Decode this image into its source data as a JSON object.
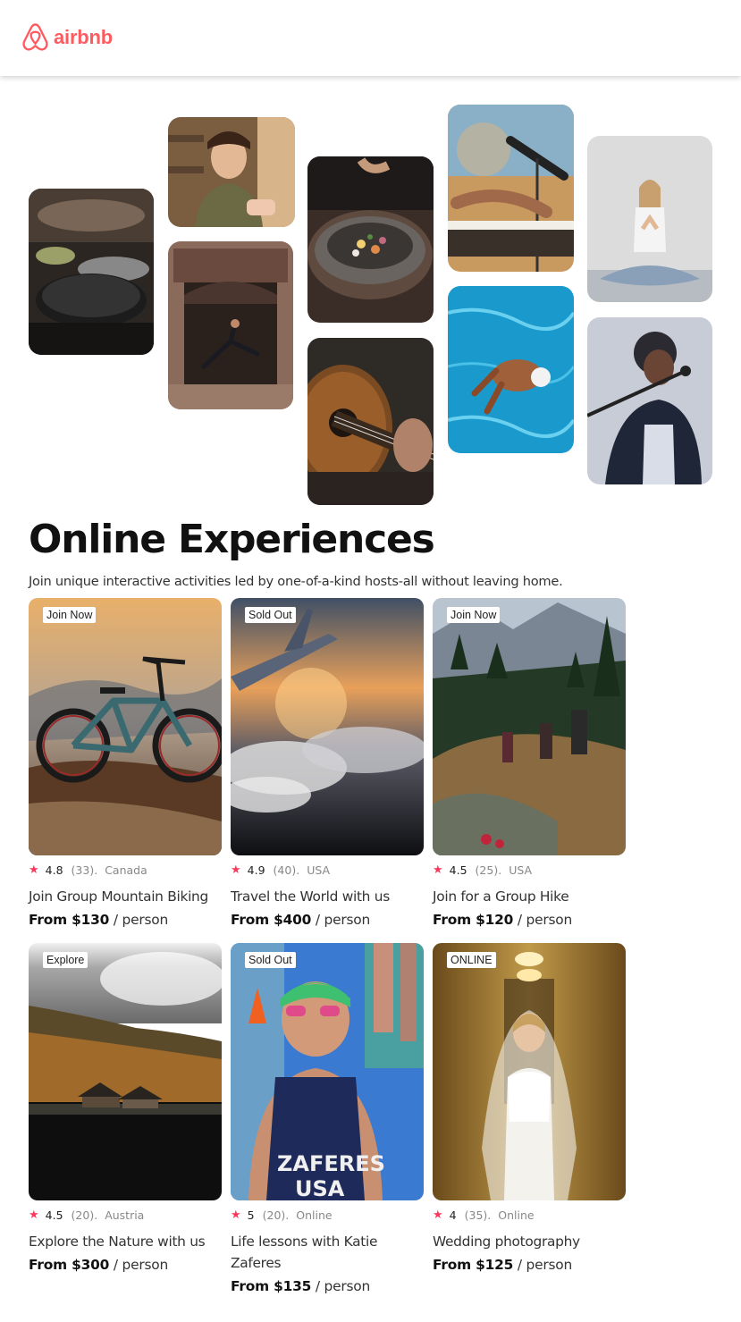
{
  "header": {
    "brand": "airbnb",
    "brand_color": "#ff5a5f",
    "logo_icon": "airbnb-belo-icon"
  },
  "gallery": [
    {
      "subject": "cooking-pans",
      "colors": [
        "#2a2a2a",
        "#6b5a4a"
      ]
    },
    {
      "subject": "chef-woman",
      "colors": [
        "#6e5238",
        "#c9a17b"
      ]
    },
    {
      "subject": "dancer-doorway",
      "colors": [
        "#7a5a4a",
        "#3b2a22"
      ]
    },
    {
      "subject": "food-bowl",
      "colors": [
        "#4a3a30",
        "#8d7a6a"
      ]
    },
    {
      "subject": "guitar",
      "colors": [
        "#3a2a20",
        "#7a5030"
      ]
    },
    {
      "subject": "piano-microphone",
      "colors": [
        "#8ab0c8",
        "#d8a060"
      ]
    },
    {
      "subject": "swimmer-pool",
      "colors": [
        "#2aa0d0",
        "#0f78a8"
      ]
    },
    {
      "subject": "yoga",
      "colors": [
        "#dcdcdc",
        "#b8c0c6"
      ]
    },
    {
      "subject": "singer",
      "colors": [
        "#c8ccd6",
        "#3a4460"
      ]
    }
  ],
  "hero": {
    "title": "Online Experiences",
    "subtitle": "Join unique interactive activities led by one-of-a-kind hosts-all without leaving home."
  },
  "cards": [
    {
      "badge": "Join Now",
      "rating": "4.8",
      "reviews": "(33).",
      "location": "Canada",
      "title": "Join Group Mountain Biking",
      "price": "From $130",
      "unit": " / person",
      "image": "mountain-bike",
      "colors": [
        "#e6b06a",
        "#6a5a50",
        "#3c2e26"
      ]
    },
    {
      "badge": "Sold Out",
      "rating": "4.9",
      "reviews": "(40).",
      "location": "USA",
      "title": "Travel the World with us",
      "price": "From $400",
      "unit": " / person",
      "image": "airplane-wing-clouds",
      "colors": [
        "#5a6a80",
        "#e09050",
        "#1c1e24"
      ]
    },
    {
      "badge": "Join Now",
      "rating": "4.5",
      "reviews": "(25).",
      "location": "USA",
      "title": "Join for a Group Hike",
      "price": "From $120",
      "unit": " / person",
      "image": "group-hike",
      "colors": [
        "#b8c4d0",
        "#2e4a30",
        "#8a6a40"
      ]
    },
    {
      "badge": "Explore",
      "rating": "4.5",
      "reviews": "(20).",
      "location": "Austria",
      "title": "Explore the Nature with us",
      "price": "From $300",
      "unit": " / person",
      "image": "lake-cabin",
      "colors": [
        "#d4d4d4",
        "#8a5a2a",
        "#141414"
      ]
    },
    {
      "badge": "Sold Out",
      "rating": "5",
      "reviews": "(20).",
      "location": "Online",
      "title": "Life lessons with Katie Zaferes",
      "price": "From $135",
      "unit": " / person",
      "image": "triathlete",
      "colors": [
        "#3a7ad0",
        "#1a2a5a",
        "#c89070"
      ]
    },
    {
      "badge": "ONLINE",
      "rating": "4",
      "reviews": "(35).",
      "location": "Online",
      "title": "Wedding photography",
      "price": "From $125",
      "unit": " / person",
      "image": "bride",
      "colors": [
        "#b08a3a",
        "#6a4a1a",
        "#f2f0ea"
      ]
    }
  ],
  "accent": "#fe385c"
}
